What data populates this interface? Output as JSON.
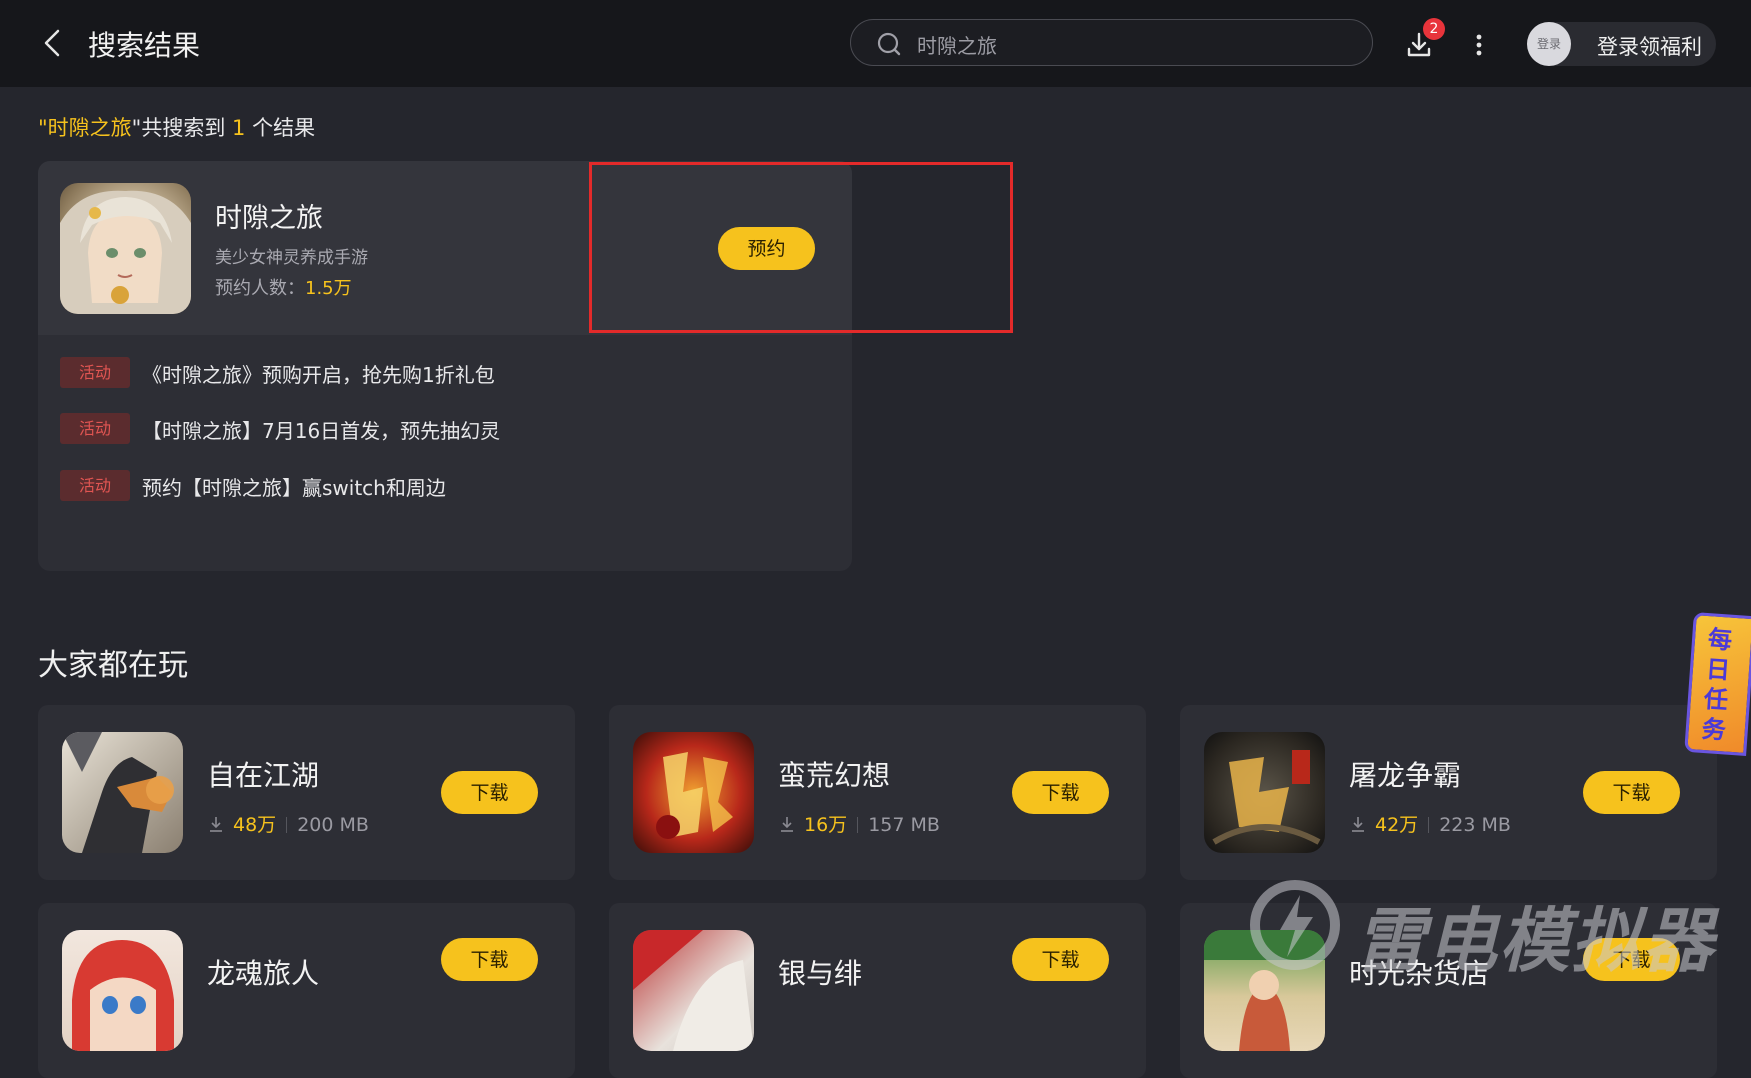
{
  "header": {
    "title": "搜索结果",
    "search_value": "时隙之旅",
    "download_badge": "2",
    "login_avatar_text": "登录",
    "login_label": "登录领福利"
  },
  "summary": {
    "open_quote": "\"",
    "keyword": "时隙之旅",
    "middle": "\"共搜索到 ",
    "count": "1",
    "suffix": " 个结果"
  },
  "result": {
    "name": "时隙之旅",
    "description": "美少女神灵养成手游",
    "reserve_label": "预约人数：",
    "reserve_count": "1.5万",
    "reserve_button": "预约",
    "activities": [
      {
        "tag": "活动",
        "text": "《时隙之旅》预购开启，抢先购1折礼包"
      },
      {
        "tag": "活动",
        "text": "【时隙之旅】7月16日首发，预先抽幻灵"
      },
      {
        "tag": "活动",
        "text": "预约【时隙之旅】赢switch和周边"
      }
    ]
  },
  "popular": {
    "title": "大家都在玩",
    "download_label": "下载",
    "games": [
      {
        "name": "自在江湖",
        "downloads": "48万",
        "size": "200 MB",
        "icon": "martial-arts-game-icon"
      },
      {
        "name": "蛮荒幻想",
        "downloads": "16万",
        "size": "157 MB",
        "icon": "chuanqi-game-icon"
      },
      {
        "name": "屠龙争霸",
        "downloads": "42万",
        "size": "223 MB",
        "icon": "tulong-game-icon"
      },
      {
        "name": "龙魂旅人",
        "icon": "redhair-girl-game-icon"
      },
      {
        "name": "银与绯",
        "icon": "silver-scarlet-game-icon"
      },
      {
        "name": "时光杂货店",
        "icon": "grocery-store-game-icon"
      }
    ]
  },
  "side": {
    "daily_task": "每日任务"
  },
  "watermark": {
    "text": "雷电模拟器"
  },
  "colors": {
    "accent": "#f6c21d",
    "background": "#25262d",
    "topbar": "#16171b",
    "card": "#2d2e35",
    "activity_tag_bg": "#5b2c2e",
    "activity_tag_text": "#e05552",
    "highlight_border": "#e32a2a",
    "badge": "#e8343b"
  }
}
